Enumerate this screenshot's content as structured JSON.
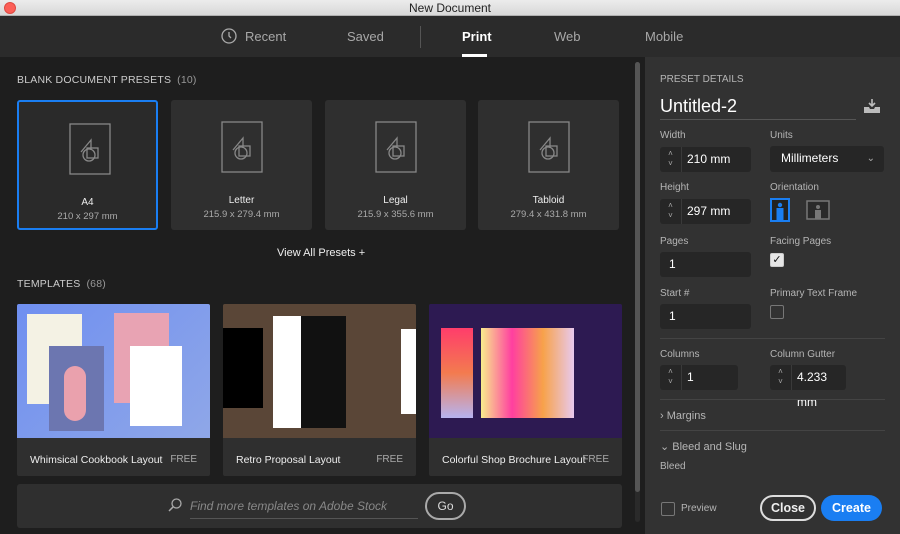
{
  "window": {
    "title": "New Document"
  },
  "tabs": [
    {
      "label": "Recent",
      "icon": "clock-icon"
    },
    {
      "label": "Saved"
    },
    {
      "label": "Print",
      "active": true
    },
    {
      "label": "Web"
    },
    {
      "label": "Mobile"
    }
  ],
  "presets": {
    "heading": "BLANK DOCUMENT PRESETS",
    "count": "(10)",
    "items": [
      {
        "name": "A4",
        "size": "210 x 297 mm",
        "selected": true
      },
      {
        "name": "Letter",
        "size": "215.9 x 279.4 mm"
      },
      {
        "name": "Legal",
        "size": "215.9 x 355.6 mm"
      },
      {
        "name": "Tabloid",
        "size": "279.4 x 431.8 mm"
      }
    ],
    "view_all": "View All Presets +"
  },
  "templates": {
    "heading": "TEMPLATES",
    "count": "(68)",
    "items": [
      {
        "name": "Whimsical Cookbook Layout",
        "price": "FREE"
      },
      {
        "name": "Retro Proposal Layout",
        "price": "FREE"
      },
      {
        "name": "Colorful Shop Brochure Layout",
        "price": "FREE"
      }
    ],
    "search_placeholder": "Find more templates on Adobe Stock",
    "go": "Go"
  },
  "details": {
    "heading": "PRESET DETAILS",
    "name": "Untitled-2",
    "width_label": "Width",
    "width": "210 mm",
    "units_label": "Units",
    "units": "Millimeters",
    "height_label": "Height",
    "height": "297 mm",
    "orientation_label": "Orientation",
    "orientation": "portrait",
    "pages_label": "Pages",
    "pages": "1",
    "facing_label": "Facing Pages",
    "facing": true,
    "start_label": "Start #",
    "start": "1",
    "ptf_label": "Primary Text Frame",
    "ptf": false,
    "columns_label": "Columns",
    "columns": "1",
    "gutter_label": "Column Gutter",
    "gutter": "4.233 mm",
    "margins": "Margins",
    "bleed_slug": "Bleed and Slug",
    "bleed": "Bleed",
    "preview": "Preview",
    "close": "Close",
    "create": "Create"
  },
  "colors": {
    "accent": "#1a7ef2"
  }
}
